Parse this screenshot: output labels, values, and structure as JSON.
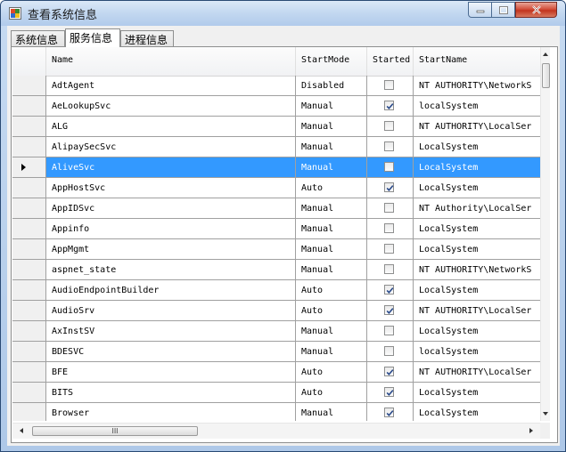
{
  "window": {
    "title": "查看系统信息"
  },
  "tabs": [
    {
      "label": "系统信息",
      "active": false
    },
    {
      "label": "服务信息",
      "active": true
    },
    {
      "label": "进程信息",
      "active": false
    }
  ],
  "grid": {
    "columns": [
      "Name",
      "StartMode",
      "Started",
      "StartName"
    ],
    "rows": [
      {
        "name": "AdtAgent",
        "start_mode": "Disabled",
        "started": false,
        "start_name": "NT AUTHORITY\\NetworkS"
      },
      {
        "name": "AeLookupSvc",
        "start_mode": "Manual",
        "started": true,
        "start_name": "localSystem"
      },
      {
        "name": "ALG",
        "start_mode": "Manual",
        "started": false,
        "start_name": "NT AUTHORITY\\LocalSer"
      },
      {
        "name": "AlipaySecSvc",
        "start_mode": "Manual",
        "started": false,
        "start_name": "LocalSystem"
      },
      {
        "name": "AliveSvc",
        "start_mode": "Manual",
        "started": false,
        "start_name": "LocalSystem",
        "selected": true
      },
      {
        "name": "AppHostSvc",
        "start_mode": "Auto",
        "started": true,
        "start_name": "LocalSystem"
      },
      {
        "name": "AppIDSvc",
        "start_mode": "Manual",
        "started": false,
        "start_name": "NT Authority\\LocalSer"
      },
      {
        "name": "Appinfo",
        "start_mode": "Manual",
        "started": false,
        "start_name": "LocalSystem"
      },
      {
        "name": "AppMgmt",
        "start_mode": "Manual",
        "started": false,
        "start_name": "LocalSystem"
      },
      {
        "name": "aspnet_state",
        "start_mode": "Manual",
        "started": false,
        "start_name": "NT AUTHORITY\\NetworkS"
      },
      {
        "name": "AudioEndpointBuilder",
        "start_mode": "Auto",
        "started": true,
        "start_name": "LocalSystem"
      },
      {
        "name": "AudioSrv",
        "start_mode": "Auto",
        "started": true,
        "start_name": "NT AUTHORITY\\LocalSer"
      },
      {
        "name": "AxInstSV",
        "start_mode": "Manual",
        "started": false,
        "start_name": "LocalSystem"
      },
      {
        "name": "BDESVC",
        "start_mode": "Manual",
        "started": false,
        "start_name": "localSystem"
      },
      {
        "name": "BFE",
        "start_mode": "Auto",
        "started": true,
        "start_name": "NT AUTHORITY\\LocalSer"
      },
      {
        "name": "BITS",
        "start_mode": "Auto",
        "started": true,
        "start_name": "LocalSystem"
      },
      {
        "name": "Browser",
        "start_mode": "Manual",
        "started": true,
        "start_name": "LocalSystem"
      }
    ]
  },
  "hscroll_grip": "III",
  "colors": {
    "selection": "#3399ff",
    "close_button": "#c2331e",
    "title_bar": "#c2d7f0"
  }
}
